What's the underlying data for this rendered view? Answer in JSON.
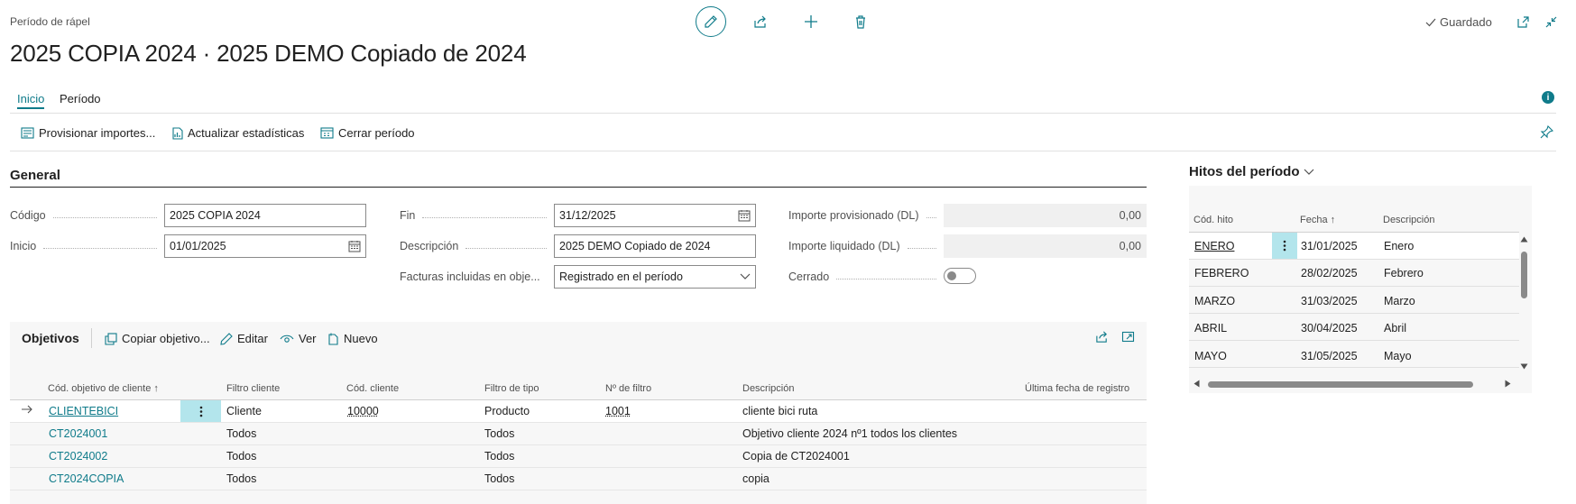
{
  "header": {
    "page_kind": "Período de rápel",
    "title": "2025 COPIA 2024 · 2025 DEMO Copiado de 2024",
    "saved_label": "Guardado"
  },
  "tabs": [
    {
      "label": "Inicio",
      "active": true
    },
    {
      "label": "Período",
      "active": false
    }
  ],
  "actions": [
    {
      "label": "Provisionar importes...",
      "icon": "provision-icon"
    },
    {
      "label": "Actualizar estadísticas",
      "icon": "stats-icon"
    },
    {
      "label": "Cerrar período",
      "icon": "close-period-icon"
    }
  ],
  "general": {
    "title": "General",
    "codigo": {
      "label": "Código",
      "value": "2025 COPIA 2024"
    },
    "inicio": {
      "label": "Inicio",
      "value": "01/01/2025"
    },
    "fin": {
      "label": "Fin",
      "value": "31/12/2025"
    },
    "descripcion": {
      "label": "Descripción",
      "value": "2025 DEMO Copiado de 2024"
    },
    "facturas": {
      "label": "Facturas incluidas en obje...",
      "value": "Registrado en el período"
    },
    "imp_prov": {
      "label": "Importe provisionado (DL)",
      "value": "0,00"
    },
    "imp_liq": {
      "label": "Importe liquidado (DL)",
      "value": "0,00"
    },
    "cerrado": {
      "label": "Cerrado",
      "value": false
    }
  },
  "objetivos": {
    "title": "Objetivos",
    "actions": [
      "Copiar objetivo...",
      "Editar",
      "Ver",
      "Nuevo"
    ],
    "columns": [
      "Cód. objetivo de cliente ↑",
      "Filtro cliente",
      "Cód. cliente",
      "Filtro de tipo",
      "Nº de filtro",
      "Descripción",
      "Última fecha de registro"
    ],
    "rows": [
      {
        "code": "CLIENTEBICI",
        "filtro_cliente": "Cliente",
        "cod_cliente": "10000",
        "filtro_tipo": "Producto",
        "n_filtro": "1001",
        "descripcion": "cliente bici ruta",
        "ultima_fecha": "",
        "selected": true
      },
      {
        "code": "CT2024001",
        "filtro_cliente": "Todos",
        "cod_cliente": "",
        "filtro_tipo": "Todos",
        "n_filtro": "",
        "descripcion": "Objetivo cliente 2024 nº1 todos los clientes",
        "ultima_fecha": ""
      },
      {
        "code": "CT2024002",
        "filtro_cliente": "Todos",
        "cod_cliente": "",
        "filtro_tipo": "Todos",
        "n_filtro": "",
        "descripcion": "Copia de CT2024001",
        "ultima_fecha": ""
      },
      {
        "code": "CT2024COPIA",
        "filtro_cliente": "Todos",
        "cod_cliente": "",
        "filtro_tipo": "Todos",
        "n_filtro": "",
        "descripcion": "copia",
        "ultima_fecha": ""
      }
    ]
  },
  "hitos": {
    "title": "Hitos del período",
    "columns": [
      "Cód. hito",
      "Fecha ↑",
      "Descripción"
    ],
    "rows": [
      {
        "code": "ENERO",
        "fecha": "31/01/2025",
        "descripcion": "Enero",
        "selected": true
      },
      {
        "code": "FEBRERO",
        "fecha": "28/02/2025",
        "descripcion": "Febrero"
      },
      {
        "code": "MARZO",
        "fecha": "31/03/2025",
        "descripcion": "Marzo"
      },
      {
        "code": "ABRIL",
        "fecha": "30/04/2025",
        "descripcion": "Abril"
      },
      {
        "code": "MAYO",
        "fecha": "31/05/2025",
        "descripcion": "Mayo"
      }
    ]
  },
  "colors": {
    "accent": "#0f7b8a",
    "selection": "#b3e5ec",
    "info": "#0f7b8a"
  }
}
